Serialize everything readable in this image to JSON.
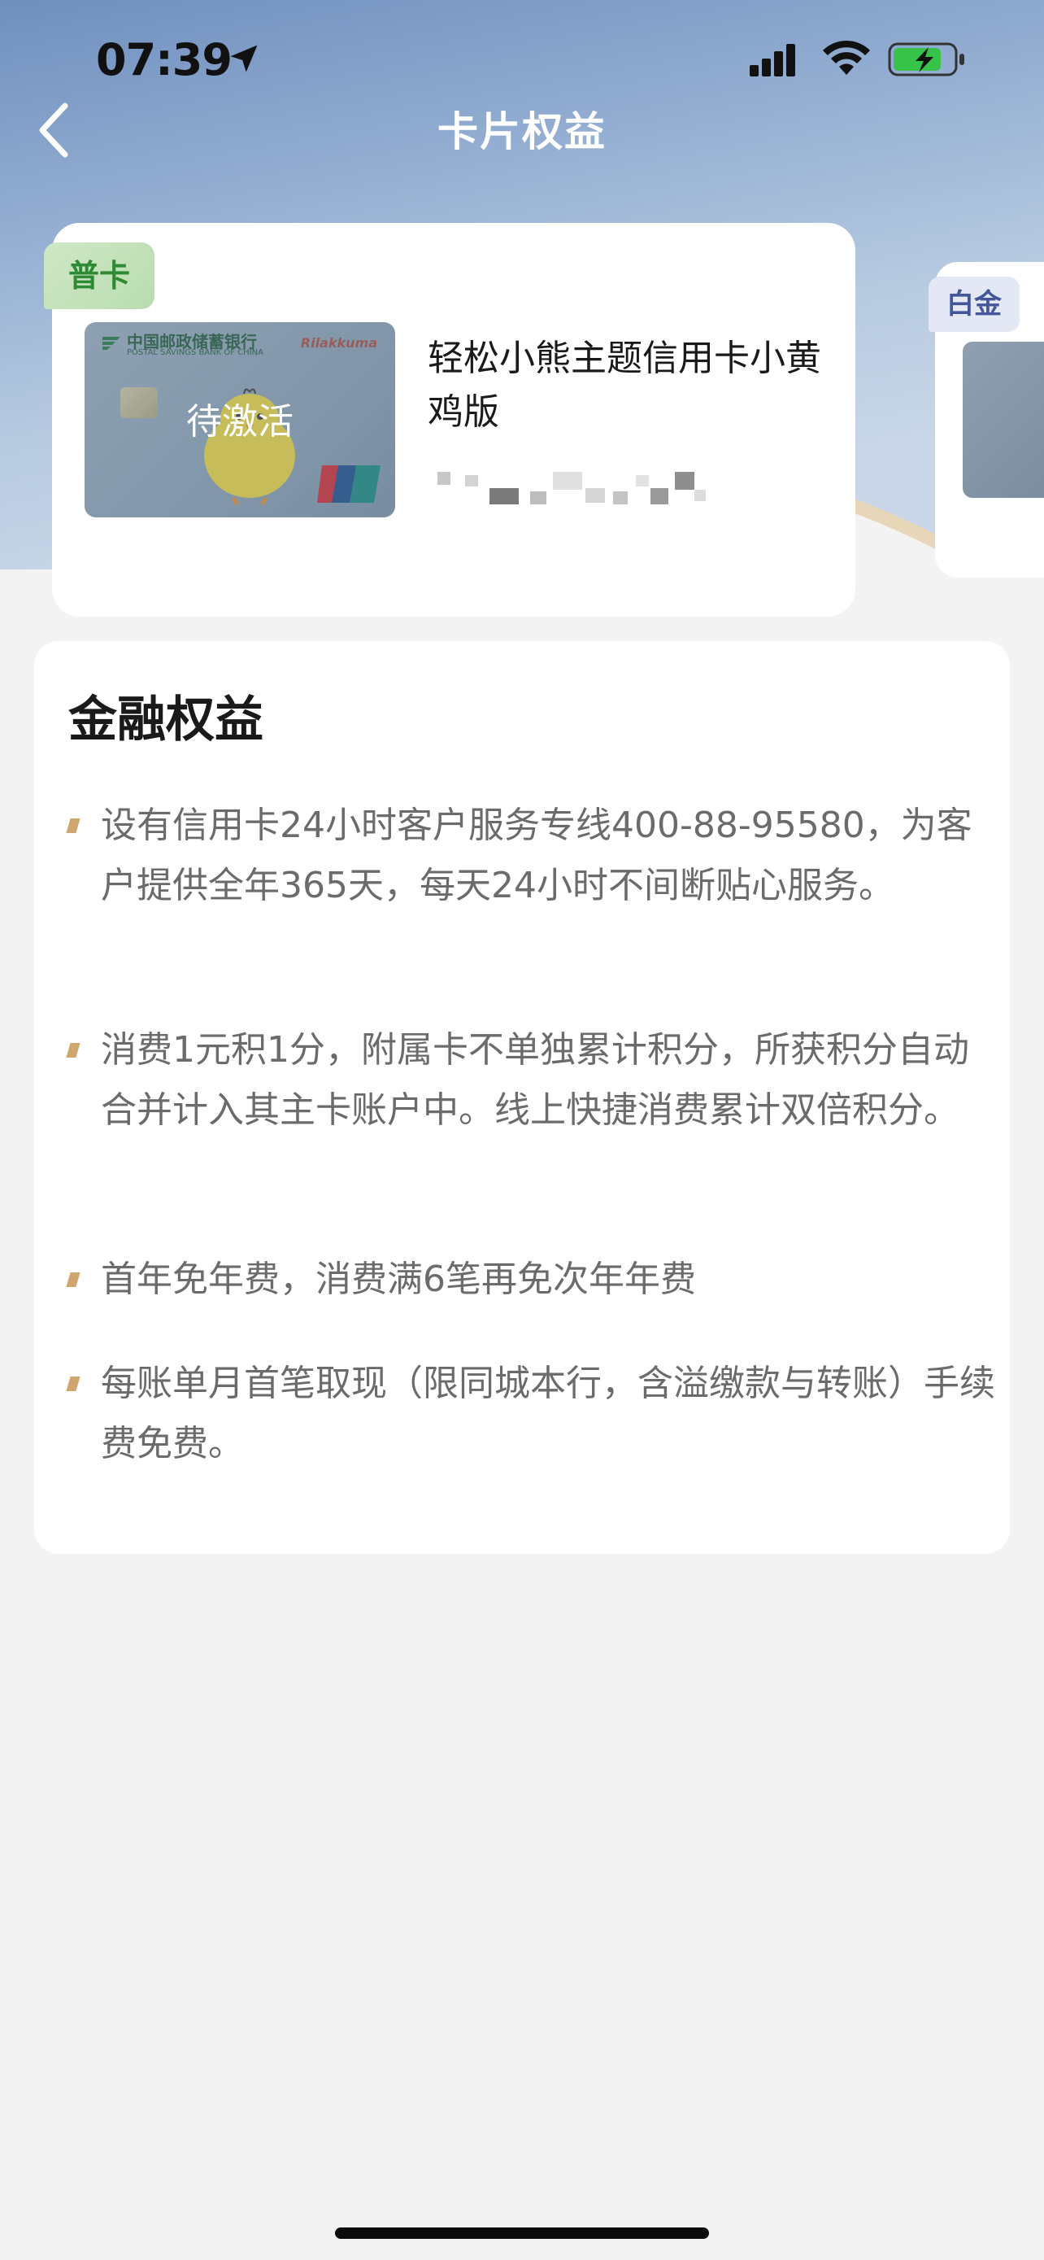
{
  "status_bar": {
    "time": "07:39"
  },
  "nav": {
    "title": "卡片权益"
  },
  "cards": [
    {
      "tier": "普卡",
      "status": "待激活",
      "name": "轻松小熊主题信用卡小黄鸡版",
      "bank_name": "中国邮政储蓄银行",
      "bank_name_en": "POSTAL SAVINGS BANK OF CHINA",
      "brand": "Rilakkuma"
    },
    {
      "tier": "白金"
    }
  ],
  "benefits": {
    "title": "金融权益",
    "items": [
      "设有信用卡24小时客户服务专线400-88-95580，为客户提供全年365天，每天24小时不间断贴心服务。",
      "消费1元积1分，附属卡不单独累计积分，所获积分自动合并计入其主卡账户中。线上快捷消费累计双倍积分。",
      "首年免年费，消费满6笔再免次年年费",
      "每账单月首笔取现（限同城本行，含溢缴款与转账）手续费免费。"
    ]
  },
  "colors": {
    "accent_gold": "#cfa66e",
    "tier_green": "#2f8a36",
    "tier_blue": "#43569a"
  }
}
